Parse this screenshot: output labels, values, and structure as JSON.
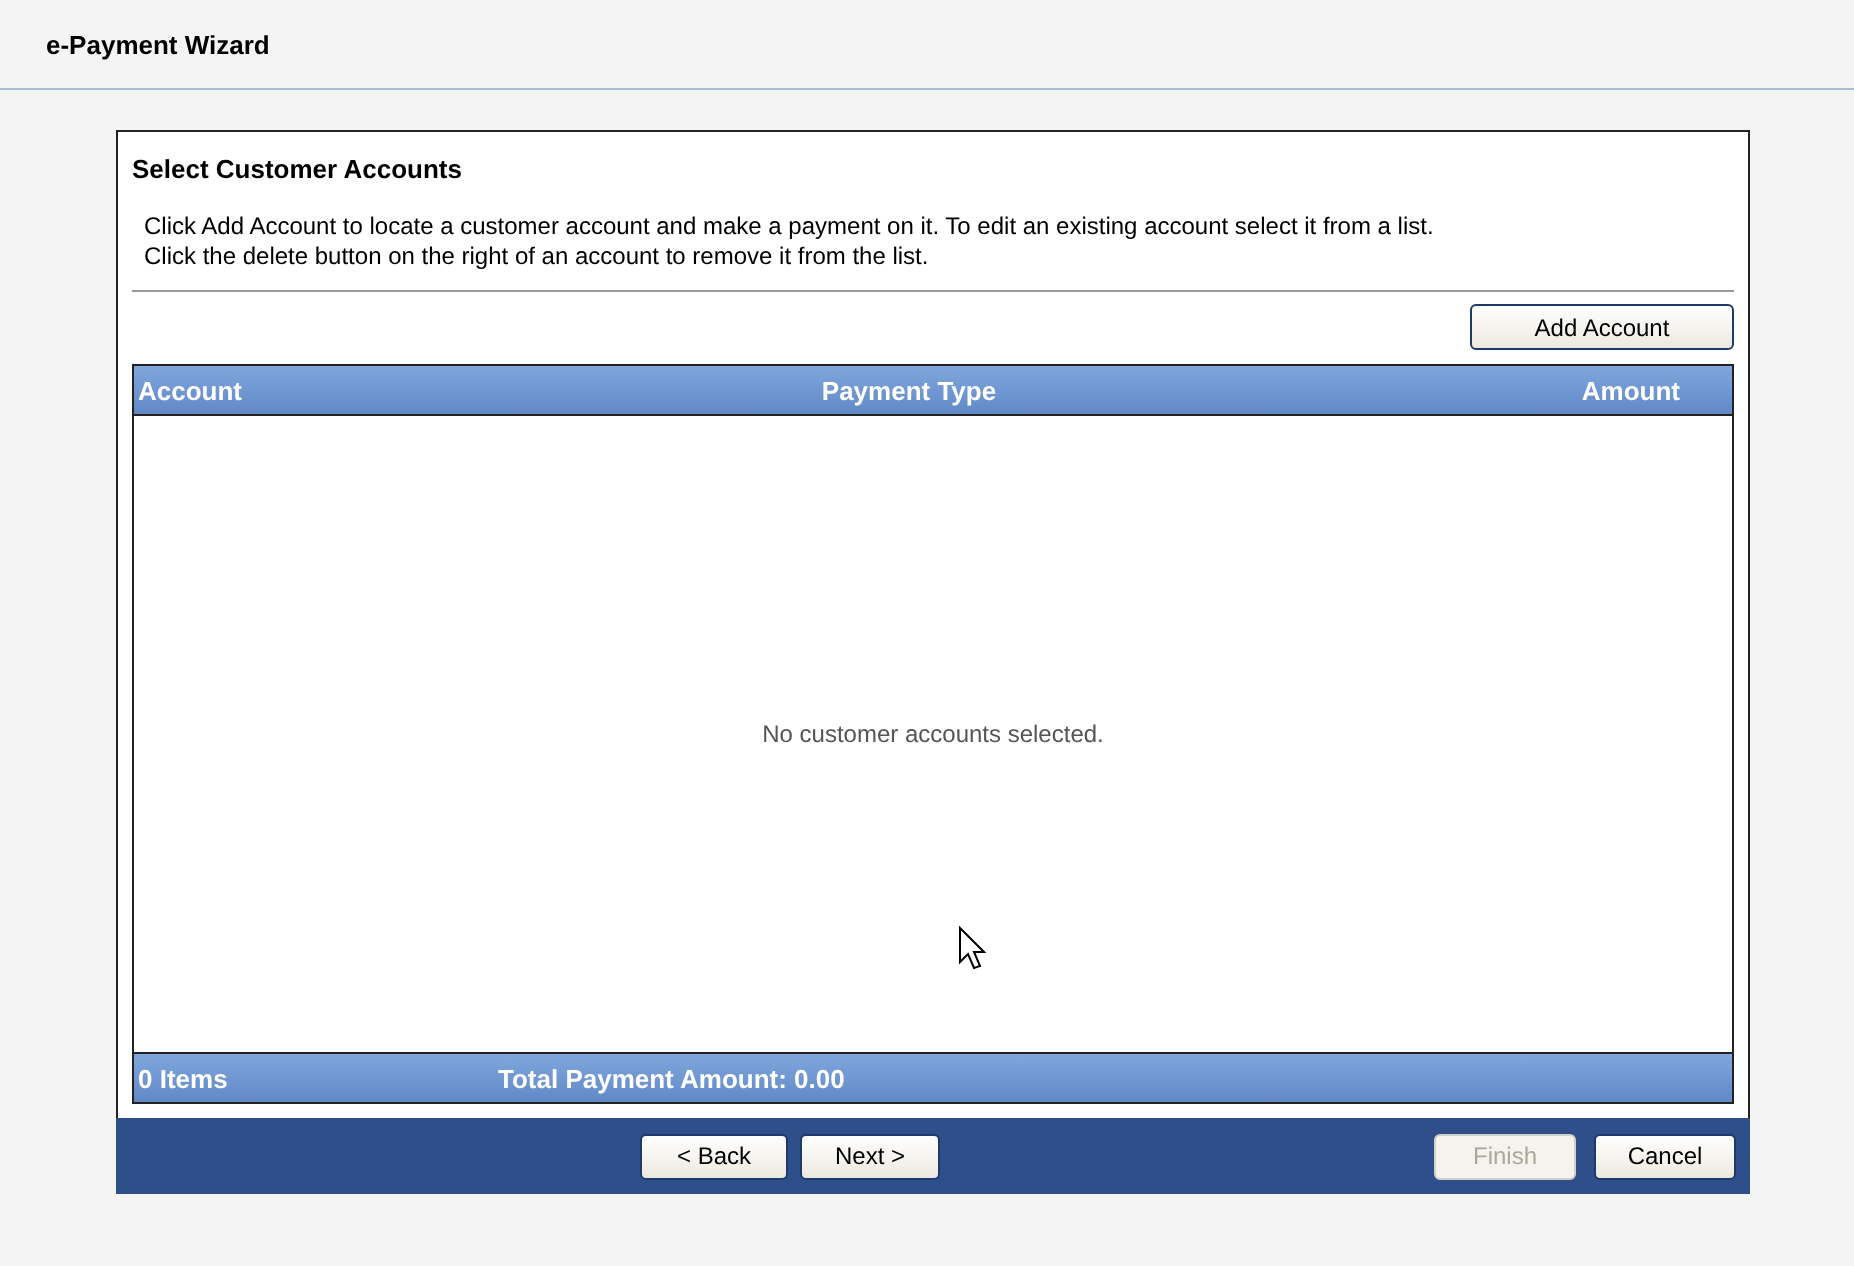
{
  "window": {
    "title": "e-Payment Wizard"
  },
  "section": {
    "title": "Select Customer Accounts",
    "description": [
      "Click Add Account to locate a customer account and make a payment on it. To edit an existing account select it from a list.",
      "Click the delete button on the right of an account to remove it from the list."
    ]
  },
  "add_button": {
    "label": "Add Account",
    "disabled": false
  },
  "table": {
    "columns": [
      "Account",
      "Payment Type",
      "Amount"
    ],
    "empty_message": "No customer accounts selected.",
    "footer": {
      "count": "0 Items",
      "total": "Total Payment Amount: 0.00"
    }
  },
  "nav_buttons": [
    {
      "label": "< Back",
      "disabled": false
    },
    {
      "label": "Next >",
      "disabled": false
    }
  ],
  "end_buttons": [
    {
      "label": "Finish",
      "disabled": true
    },
    {
      "label": "Cancel",
      "disabled": false
    }
  ]
}
